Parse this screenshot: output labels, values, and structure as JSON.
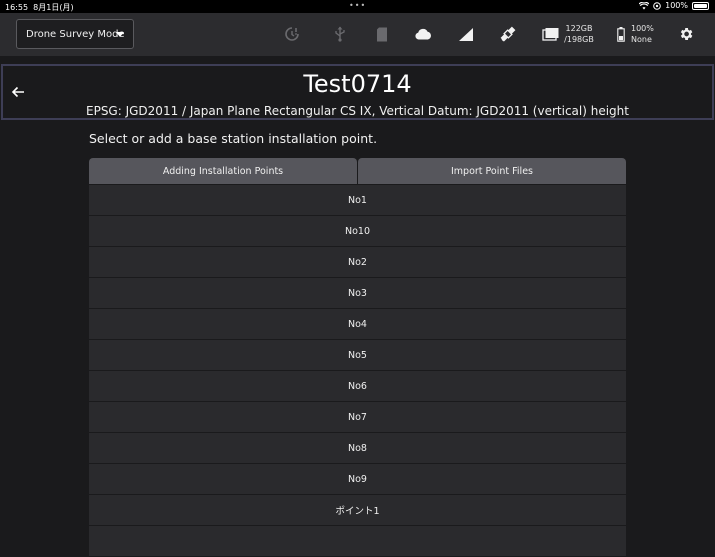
{
  "status_bar": {
    "time": "16:55",
    "date": "8月1日(月)",
    "battery": "100%"
  },
  "toolbar": {
    "mode_label": "Drone Survey Mode",
    "storage_used": "122GB",
    "storage_total": "/198GB",
    "device_battery": "100%",
    "device_status": "None"
  },
  "header": {
    "title": "Test0714",
    "subtitle": "EPSG: JGD2011 / Japan Plane Rectangular CS IX, Vertical Datum: JGD2011 (vertical) height"
  },
  "main": {
    "instruction": "Select or add a base station installation point.",
    "tabs": [
      {
        "label": "Adding Installation Points"
      },
      {
        "label": "Import Point Files"
      }
    ],
    "points": [
      "No1",
      "No10",
      "No2",
      "No3",
      "No4",
      "No5",
      "No6",
      "No7",
      "No8",
      "No9",
      "ポイント1",
      ""
    ]
  },
  "icons": {
    "timer": "timer-alert-icon",
    "usb": "usb-icon",
    "sd": "sd-card-icon",
    "cloud": "cloud-icon",
    "signal": "signal-icon",
    "satellite": "satellite-icon",
    "folder": "folder-icon",
    "battery": "battery-icon",
    "settings": "gear-icon"
  }
}
